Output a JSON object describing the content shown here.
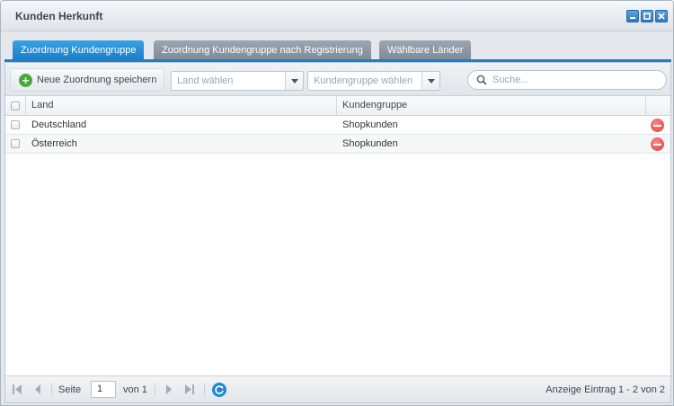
{
  "window": {
    "title": "Kunden Herkunft",
    "controls": [
      "minimize-icon",
      "maximize-icon",
      "close-icon"
    ]
  },
  "tabs": [
    {
      "label": "Zuordnung Kundengruppe",
      "active": true
    },
    {
      "label": "Zuordnung Kundengruppe nach Registrierung",
      "active": false
    },
    {
      "label": "Wählbare Länder",
      "active": false
    }
  ],
  "toolbar": {
    "save_label": "Neue Zuordnung speichern",
    "country_placeholder": "Land wählen",
    "group_placeholder": "Kundengruppe wählen",
    "search_placeholder": "Suche..."
  },
  "grid": {
    "columns": [
      "Land",
      "Kundengruppe"
    ],
    "rows": [
      {
        "land": "Deutschland",
        "group": "Shopkunden"
      },
      {
        "land": "Österreich",
        "group": "Shopkunden"
      }
    ]
  },
  "pager": {
    "page_label": "Seite",
    "page_value": "1",
    "of_label": "von 1",
    "info": "Anzeige Eintrag 1 - 2 von 2"
  },
  "colors": {
    "accent": "#1b80cb",
    "add": "#4aa83a",
    "delete": "#d93b35"
  }
}
